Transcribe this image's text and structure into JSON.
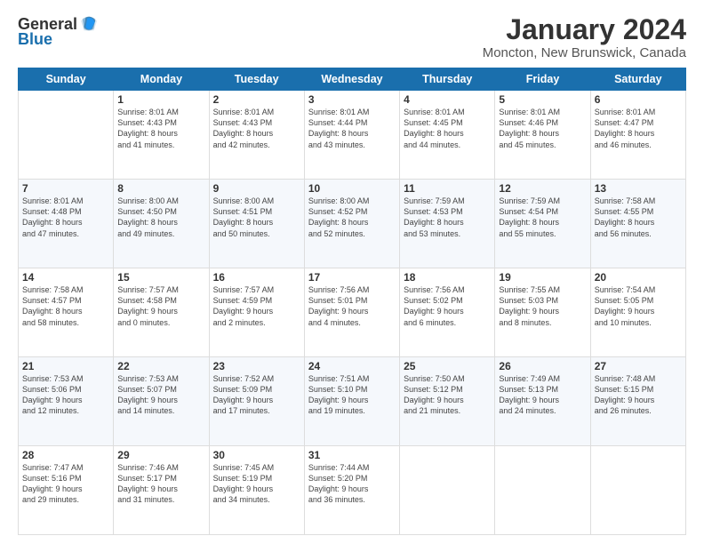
{
  "header": {
    "logo_general": "General",
    "logo_blue": "Blue",
    "title": "January 2024",
    "location": "Moncton, New Brunswick, Canada"
  },
  "weekdays": [
    "Sunday",
    "Monday",
    "Tuesday",
    "Wednesday",
    "Thursday",
    "Friday",
    "Saturday"
  ],
  "weeks": [
    [
      {
        "day": "",
        "info": ""
      },
      {
        "day": "1",
        "info": "Sunrise: 8:01 AM\nSunset: 4:43 PM\nDaylight: 8 hours\nand 41 minutes."
      },
      {
        "day": "2",
        "info": "Sunrise: 8:01 AM\nSunset: 4:43 PM\nDaylight: 8 hours\nand 42 minutes."
      },
      {
        "day": "3",
        "info": "Sunrise: 8:01 AM\nSunset: 4:44 PM\nDaylight: 8 hours\nand 43 minutes."
      },
      {
        "day": "4",
        "info": "Sunrise: 8:01 AM\nSunset: 4:45 PM\nDaylight: 8 hours\nand 44 minutes."
      },
      {
        "day": "5",
        "info": "Sunrise: 8:01 AM\nSunset: 4:46 PM\nDaylight: 8 hours\nand 45 minutes."
      },
      {
        "day": "6",
        "info": "Sunrise: 8:01 AM\nSunset: 4:47 PM\nDaylight: 8 hours\nand 46 minutes."
      }
    ],
    [
      {
        "day": "7",
        "info": "Sunrise: 8:01 AM\nSunset: 4:48 PM\nDaylight: 8 hours\nand 47 minutes."
      },
      {
        "day": "8",
        "info": "Sunrise: 8:00 AM\nSunset: 4:50 PM\nDaylight: 8 hours\nand 49 minutes."
      },
      {
        "day": "9",
        "info": "Sunrise: 8:00 AM\nSunset: 4:51 PM\nDaylight: 8 hours\nand 50 minutes."
      },
      {
        "day": "10",
        "info": "Sunrise: 8:00 AM\nSunset: 4:52 PM\nDaylight: 8 hours\nand 52 minutes."
      },
      {
        "day": "11",
        "info": "Sunrise: 7:59 AM\nSunset: 4:53 PM\nDaylight: 8 hours\nand 53 minutes."
      },
      {
        "day": "12",
        "info": "Sunrise: 7:59 AM\nSunset: 4:54 PM\nDaylight: 8 hours\nand 55 minutes."
      },
      {
        "day": "13",
        "info": "Sunrise: 7:58 AM\nSunset: 4:55 PM\nDaylight: 8 hours\nand 56 minutes."
      }
    ],
    [
      {
        "day": "14",
        "info": "Sunrise: 7:58 AM\nSunset: 4:57 PM\nDaylight: 8 hours\nand 58 minutes."
      },
      {
        "day": "15",
        "info": "Sunrise: 7:57 AM\nSunset: 4:58 PM\nDaylight: 9 hours\nand 0 minutes."
      },
      {
        "day": "16",
        "info": "Sunrise: 7:57 AM\nSunset: 4:59 PM\nDaylight: 9 hours\nand 2 minutes."
      },
      {
        "day": "17",
        "info": "Sunrise: 7:56 AM\nSunset: 5:01 PM\nDaylight: 9 hours\nand 4 minutes."
      },
      {
        "day": "18",
        "info": "Sunrise: 7:56 AM\nSunset: 5:02 PM\nDaylight: 9 hours\nand 6 minutes."
      },
      {
        "day": "19",
        "info": "Sunrise: 7:55 AM\nSunset: 5:03 PM\nDaylight: 9 hours\nand 8 minutes."
      },
      {
        "day": "20",
        "info": "Sunrise: 7:54 AM\nSunset: 5:05 PM\nDaylight: 9 hours\nand 10 minutes."
      }
    ],
    [
      {
        "day": "21",
        "info": "Sunrise: 7:53 AM\nSunset: 5:06 PM\nDaylight: 9 hours\nand 12 minutes."
      },
      {
        "day": "22",
        "info": "Sunrise: 7:53 AM\nSunset: 5:07 PM\nDaylight: 9 hours\nand 14 minutes."
      },
      {
        "day": "23",
        "info": "Sunrise: 7:52 AM\nSunset: 5:09 PM\nDaylight: 9 hours\nand 17 minutes."
      },
      {
        "day": "24",
        "info": "Sunrise: 7:51 AM\nSunset: 5:10 PM\nDaylight: 9 hours\nand 19 minutes."
      },
      {
        "day": "25",
        "info": "Sunrise: 7:50 AM\nSunset: 5:12 PM\nDaylight: 9 hours\nand 21 minutes."
      },
      {
        "day": "26",
        "info": "Sunrise: 7:49 AM\nSunset: 5:13 PM\nDaylight: 9 hours\nand 24 minutes."
      },
      {
        "day": "27",
        "info": "Sunrise: 7:48 AM\nSunset: 5:15 PM\nDaylight: 9 hours\nand 26 minutes."
      }
    ],
    [
      {
        "day": "28",
        "info": "Sunrise: 7:47 AM\nSunset: 5:16 PM\nDaylight: 9 hours\nand 29 minutes."
      },
      {
        "day": "29",
        "info": "Sunrise: 7:46 AM\nSunset: 5:17 PM\nDaylight: 9 hours\nand 31 minutes."
      },
      {
        "day": "30",
        "info": "Sunrise: 7:45 AM\nSunset: 5:19 PM\nDaylight: 9 hours\nand 34 minutes."
      },
      {
        "day": "31",
        "info": "Sunrise: 7:44 AM\nSunset: 5:20 PM\nDaylight: 9 hours\nand 36 minutes."
      },
      {
        "day": "",
        "info": ""
      },
      {
        "day": "",
        "info": ""
      },
      {
        "day": "",
        "info": ""
      }
    ]
  ]
}
